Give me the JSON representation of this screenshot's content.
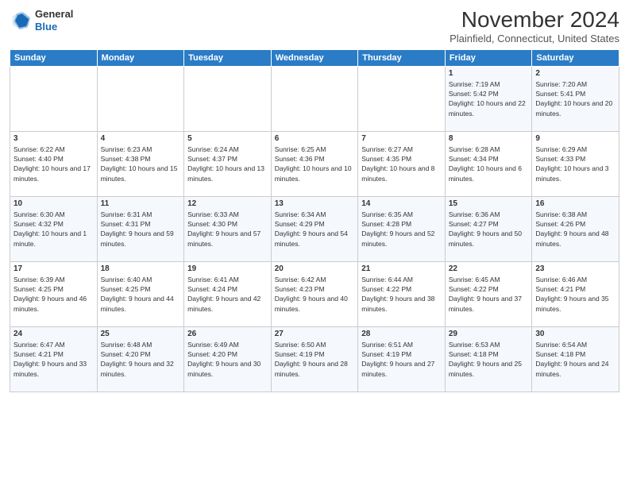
{
  "logo": {
    "general": "General",
    "blue": "Blue"
  },
  "title": "November 2024",
  "location": "Plainfield, Connecticut, United States",
  "days_of_week": [
    "Sunday",
    "Monday",
    "Tuesday",
    "Wednesday",
    "Thursday",
    "Friday",
    "Saturday"
  ],
  "weeks": [
    [
      {
        "day": "",
        "info": ""
      },
      {
        "day": "",
        "info": ""
      },
      {
        "day": "",
        "info": ""
      },
      {
        "day": "",
        "info": ""
      },
      {
        "day": "",
        "info": ""
      },
      {
        "day": "1",
        "info": "Sunrise: 7:19 AM\nSunset: 5:42 PM\nDaylight: 10 hours and 22 minutes."
      },
      {
        "day": "2",
        "info": "Sunrise: 7:20 AM\nSunset: 5:41 PM\nDaylight: 10 hours and 20 minutes."
      }
    ],
    [
      {
        "day": "3",
        "info": "Sunrise: 6:22 AM\nSunset: 4:40 PM\nDaylight: 10 hours and 17 minutes."
      },
      {
        "day": "4",
        "info": "Sunrise: 6:23 AM\nSunset: 4:38 PM\nDaylight: 10 hours and 15 minutes."
      },
      {
        "day": "5",
        "info": "Sunrise: 6:24 AM\nSunset: 4:37 PM\nDaylight: 10 hours and 13 minutes."
      },
      {
        "day": "6",
        "info": "Sunrise: 6:25 AM\nSunset: 4:36 PM\nDaylight: 10 hours and 10 minutes."
      },
      {
        "day": "7",
        "info": "Sunrise: 6:27 AM\nSunset: 4:35 PM\nDaylight: 10 hours and 8 minutes."
      },
      {
        "day": "8",
        "info": "Sunrise: 6:28 AM\nSunset: 4:34 PM\nDaylight: 10 hours and 6 minutes."
      },
      {
        "day": "9",
        "info": "Sunrise: 6:29 AM\nSunset: 4:33 PM\nDaylight: 10 hours and 3 minutes."
      }
    ],
    [
      {
        "day": "10",
        "info": "Sunrise: 6:30 AM\nSunset: 4:32 PM\nDaylight: 10 hours and 1 minute."
      },
      {
        "day": "11",
        "info": "Sunrise: 6:31 AM\nSunset: 4:31 PM\nDaylight: 9 hours and 59 minutes."
      },
      {
        "day": "12",
        "info": "Sunrise: 6:33 AM\nSunset: 4:30 PM\nDaylight: 9 hours and 57 minutes."
      },
      {
        "day": "13",
        "info": "Sunrise: 6:34 AM\nSunset: 4:29 PM\nDaylight: 9 hours and 54 minutes."
      },
      {
        "day": "14",
        "info": "Sunrise: 6:35 AM\nSunset: 4:28 PM\nDaylight: 9 hours and 52 minutes."
      },
      {
        "day": "15",
        "info": "Sunrise: 6:36 AM\nSunset: 4:27 PM\nDaylight: 9 hours and 50 minutes."
      },
      {
        "day": "16",
        "info": "Sunrise: 6:38 AM\nSunset: 4:26 PM\nDaylight: 9 hours and 48 minutes."
      }
    ],
    [
      {
        "day": "17",
        "info": "Sunrise: 6:39 AM\nSunset: 4:25 PM\nDaylight: 9 hours and 46 minutes."
      },
      {
        "day": "18",
        "info": "Sunrise: 6:40 AM\nSunset: 4:25 PM\nDaylight: 9 hours and 44 minutes."
      },
      {
        "day": "19",
        "info": "Sunrise: 6:41 AM\nSunset: 4:24 PM\nDaylight: 9 hours and 42 minutes."
      },
      {
        "day": "20",
        "info": "Sunrise: 6:42 AM\nSunset: 4:23 PM\nDaylight: 9 hours and 40 minutes."
      },
      {
        "day": "21",
        "info": "Sunrise: 6:44 AM\nSunset: 4:22 PM\nDaylight: 9 hours and 38 minutes."
      },
      {
        "day": "22",
        "info": "Sunrise: 6:45 AM\nSunset: 4:22 PM\nDaylight: 9 hours and 37 minutes."
      },
      {
        "day": "23",
        "info": "Sunrise: 6:46 AM\nSunset: 4:21 PM\nDaylight: 9 hours and 35 minutes."
      }
    ],
    [
      {
        "day": "24",
        "info": "Sunrise: 6:47 AM\nSunset: 4:21 PM\nDaylight: 9 hours and 33 minutes."
      },
      {
        "day": "25",
        "info": "Sunrise: 6:48 AM\nSunset: 4:20 PM\nDaylight: 9 hours and 32 minutes."
      },
      {
        "day": "26",
        "info": "Sunrise: 6:49 AM\nSunset: 4:20 PM\nDaylight: 9 hours and 30 minutes."
      },
      {
        "day": "27",
        "info": "Sunrise: 6:50 AM\nSunset: 4:19 PM\nDaylight: 9 hours and 28 minutes."
      },
      {
        "day": "28",
        "info": "Sunrise: 6:51 AM\nSunset: 4:19 PM\nDaylight: 9 hours and 27 minutes."
      },
      {
        "day": "29",
        "info": "Sunrise: 6:53 AM\nSunset: 4:18 PM\nDaylight: 9 hours and 25 minutes."
      },
      {
        "day": "30",
        "info": "Sunrise: 6:54 AM\nSunset: 4:18 PM\nDaylight: 9 hours and 24 minutes."
      }
    ]
  ]
}
